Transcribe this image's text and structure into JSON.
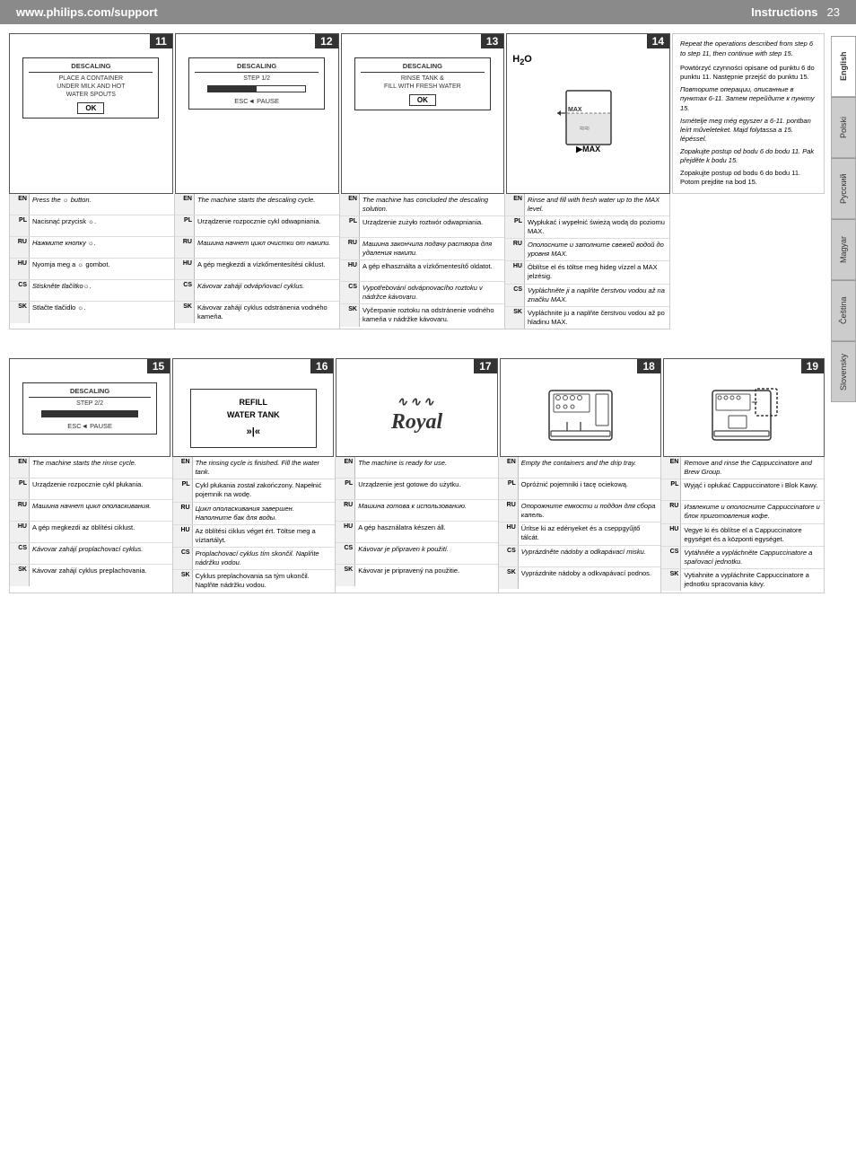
{
  "header": {
    "website": "www.philips.com/support",
    "section": "Instructions",
    "page_number": "23"
  },
  "languages": [
    {
      "code": "EN",
      "label": "English"
    },
    {
      "code": "PL",
      "label": "Polski"
    },
    {
      "code": "RU",
      "label": "Русский"
    },
    {
      "code": "HU",
      "label": "Magyar"
    },
    {
      "code": "CS",
      "label": "Čeština"
    },
    {
      "code": "SK",
      "label": "Slovensky"
    }
  ],
  "row1": {
    "steps": [
      {
        "number": "11",
        "display": {
          "label": "DESCALING",
          "text": "PLACE A CONTAINER\nUNDER MILK AND HOT\nWATER SPOUTS",
          "button": "OK"
        }
      },
      {
        "number": "12",
        "display": {
          "label": "DESCALING",
          "subtext": "STEP 1/2",
          "progress": 50,
          "esc": "ESC◄ PAUSE"
        }
      },
      {
        "number": "13",
        "display": {
          "label": "DESCALING",
          "text": "RINSE TANK &\nFILL WITH FRESH WATER",
          "button": "OK"
        }
      },
      {
        "number": "14",
        "type": "illustration",
        "h2o": "H₂O",
        "max": "MAX"
      }
    ],
    "note": {
      "italic": "Repeat the operations described from step 6 to step 11, then continue with step 15.",
      "languages": [
        {
          "code": "PL",
          "text": "Powtórzyć czynności opisane od punktu 6 do punktu 11. Następnie przejść do punktu 15."
        },
        {
          "code": "RU",
          "text": "Повторите операции, описанные в пунктах 6-11. Затем перейдите к пункту 15.",
          "italic": true
        },
        {
          "code": "HU",
          "text": "Ismételje meg még egyszer a 6-11. pontban leírt műveleteket. Majd folytassa a 15. lépéssel.",
          "italic": true
        },
        {
          "code": "CS",
          "text": "Zopakujte postup od bodu 6 do bodu 11. Pak přejděte k bodu 15.",
          "italic": true
        },
        {
          "code": "SK",
          "text": "Zopakujte postup od bodu 6 do bodu 11. Potom prejdite na bod 15."
        }
      ]
    }
  },
  "row1_text": {
    "cols": [
      {
        "rows": [
          {
            "lang": "EN",
            "text": "Press the ☼ button.",
            "italic": true
          },
          {
            "lang": "PL",
            "text": "Nacisnąć przycisk ☼.",
            "italic": false
          },
          {
            "lang": "RU",
            "text": "Нажмите кнопку ☼.",
            "italic": true
          },
          {
            "lang": "HU",
            "text": "Nyomja meg a ☼ gombot.",
            "italic": false
          },
          {
            "lang": "CS",
            "text": "Stiskněte tlačítko☼.",
            "italic": true
          },
          {
            "lang": "SK",
            "text": "Stlačte tlačidlo ☼.",
            "italic": false
          }
        ]
      },
      {
        "rows": [
          {
            "lang": "EN",
            "text": "The machine starts the descaling cycle.",
            "italic": true
          },
          {
            "lang": "PL",
            "text": "Urządzenie rozpocznie cykl odwapniania.",
            "italic": false
          },
          {
            "lang": "RU",
            "text": "Машина начнет цикл очистки от накипи.",
            "italic": true
          },
          {
            "lang": "HU",
            "text": "A gép megkezdi a vízkőmentesítési ciklust.",
            "italic": false
          },
          {
            "lang": "CS",
            "text": "Kávovar zahájí odvápňovací cyklus.",
            "italic": true
          },
          {
            "lang": "SK",
            "text": "Kávovar zahájí cyklus odstránenia vodného kameňa.",
            "italic": false
          }
        ]
      },
      {
        "rows": [
          {
            "lang": "EN",
            "text": "The machine has concluded the descaling solution.",
            "italic": true
          },
          {
            "lang": "PL",
            "text": "Urządzenie zużyło roztwór odwapniania.",
            "italic": false
          },
          {
            "lang": "RU",
            "text": "Машина закончила подачу раствора для удаления накипи.",
            "italic": true
          },
          {
            "lang": "HU",
            "text": "A gép elhasználta a vízkőmentesítő oldatot.",
            "italic": false
          },
          {
            "lang": "CS",
            "text": "Vypotřebování odvápnovacího roztoku v nádržce kávovaru.",
            "italic": true
          },
          {
            "lang": "SK",
            "text": "Vyčerpanie roztoku na odstránenie vodného kameňa v nádržke kávovaru.",
            "italic": false
          }
        ]
      },
      {
        "rows": [
          {
            "lang": "EN",
            "text": "Rinse and fill with fresh water up to the MAX level.",
            "italic": true
          },
          {
            "lang": "PL",
            "text": "Wypłukać i wypełnić świeżą wodą do poziomu MAX.",
            "italic": false
          },
          {
            "lang": "RU",
            "text": "Ополосните и заполните свежей водой до уровня MAX.",
            "italic": true
          },
          {
            "lang": "HU",
            "text": "Öblítse el és töltse meg hideg vízzel a MAX jelzésig.",
            "italic": false
          },
          {
            "lang": "CS",
            "text": "Vypláchnĕte ji a naplňte čerstvou vodou až na značku MAX.",
            "italic": true
          },
          {
            "lang": "SK",
            "text": "Vypláchnite ju a naplňte čerstvou vodou až po hladinu MAX.",
            "italic": false
          }
        ]
      }
    ]
  },
  "row2": {
    "steps": [
      {
        "number": "15",
        "display": {
          "label": "DESCALING",
          "subtext": "STEP 2/2",
          "progress": 100,
          "esc": "ESC◄ PAUSE"
        }
      },
      {
        "number": "16",
        "type": "refill",
        "text1": "REFILL",
        "text2": "WATER TANK",
        "arrows": "»|«"
      },
      {
        "number": "17",
        "type": "royal"
      },
      {
        "number": "18",
        "type": "machine"
      },
      {
        "number": "19",
        "type": "machine2"
      }
    ]
  },
  "row2_text": {
    "cols": [
      {
        "rows": [
          {
            "lang": "EN",
            "text": "The machine starts the rinse cycle.",
            "italic": true
          },
          {
            "lang": "PL",
            "text": "Urządzenie rozpocznie cykl płukania.",
            "italic": false
          },
          {
            "lang": "RU",
            "text": "Машина начнет цикл ополаскивания.",
            "italic": true
          },
          {
            "lang": "HU",
            "text": "A gép megkezdi az öblítési ciklust.",
            "italic": false
          },
          {
            "lang": "CS",
            "text": "Kávovar zahájí proplachovací cyklus.",
            "italic": true
          },
          {
            "lang": "SK",
            "text": "Kávovar zahájí cyklus preplachovania.",
            "italic": false
          }
        ]
      },
      {
        "rows": [
          {
            "lang": "EN",
            "text": "The rinsing cycle is finished. Fill the water tank.",
            "italic": true
          },
          {
            "lang": "PL",
            "text": "Cykl płukania został zakończony. Napełnić pojemnik na wodę.",
            "italic": false
          },
          {
            "lang": "RU",
            "text": "Цикл ополаскивания завершен. Наполните бак для воды.",
            "italic": true
          },
          {
            "lang": "HU",
            "text": "Az öblítési ciklus véget ért. Töltse meg a víztartályt.",
            "italic": false
          },
          {
            "lang": "CS",
            "text": "Proplachovací cyklus tím skončil. Naplňte nádržku vodou.",
            "italic": true
          },
          {
            "lang": "SK",
            "text": "Cyklus preplachovania sa tým ukončil. Naplňte nádržku vodou.",
            "italic": false
          }
        ]
      },
      {
        "rows": [
          {
            "lang": "EN",
            "text": "The machine is ready for use.",
            "italic": true
          },
          {
            "lang": "PL",
            "text": "Urządzenie jest gotowe do użytku.",
            "italic": false
          },
          {
            "lang": "RU",
            "text": "Машина готова к использованию.",
            "italic": true
          },
          {
            "lang": "HU",
            "text": "A gép használatra készen áll.",
            "italic": false
          },
          {
            "lang": "CS",
            "text": "Kávovar je připraven k použití.",
            "italic": true
          },
          {
            "lang": "SK",
            "text": "Kávovar je pripravený na použitie.",
            "italic": false
          }
        ]
      },
      {
        "rows": [
          {
            "lang": "EN",
            "text": "Empty the containers and the drip tray.",
            "italic": true
          },
          {
            "lang": "PL",
            "text": "Opróżnić pojemniki i tacę ociekową.",
            "italic": false
          },
          {
            "lang": "RU",
            "text": "Опорожните емкости и поддон для сбора капель.",
            "italic": true
          },
          {
            "lang": "HU",
            "text": "Ürítse ki az edényeket és a cseppgyűjtő tálcát.",
            "italic": false
          },
          {
            "lang": "CS",
            "text": "Vyprázdněte nádoby a odkapávací misku.",
            "italic": true
          },
          {
            "lang": "SK",
            "text": "Vyprázdnite nádoby a odkvapávací podnos.",
            "italic": false
          }
        ]
      },
      {
        "rows": [
          {
            "lang": "EN",
            "text": "Remove and rinse the Cappuccinatore and Brew Group.",
            "italic": true
          },
          {
            "lang": "PL",
            "text": "Wyjąć i opłukać Cappuccinatore i Blok Kawy.",
            "italic": false
          },
          {
            "lang": "RU",
            "text": "Извлеките и ополосните Cappuccinatore и блок приготовления кофе.",
            "italic": true
          },
          {
            "lang": "HU",
            "text": "Vegye ki és öblítse el a Cappuccinatore egységet és a központi egységet.",
            "italic": false
          },
          {
            "lang": "CS",
            "text": "Vytáhněte a vypláchnĕte Cappuccinatore a spařovací jednotku.",
            "italic": true
          },
          {
            "lang": "SK",
            "text": "Vytiahnite a vypláchnite Cappuccinatore a jednotku spracovania kávy.",
            "italic": false
          }
        ]
      }
    ]
  }
}
